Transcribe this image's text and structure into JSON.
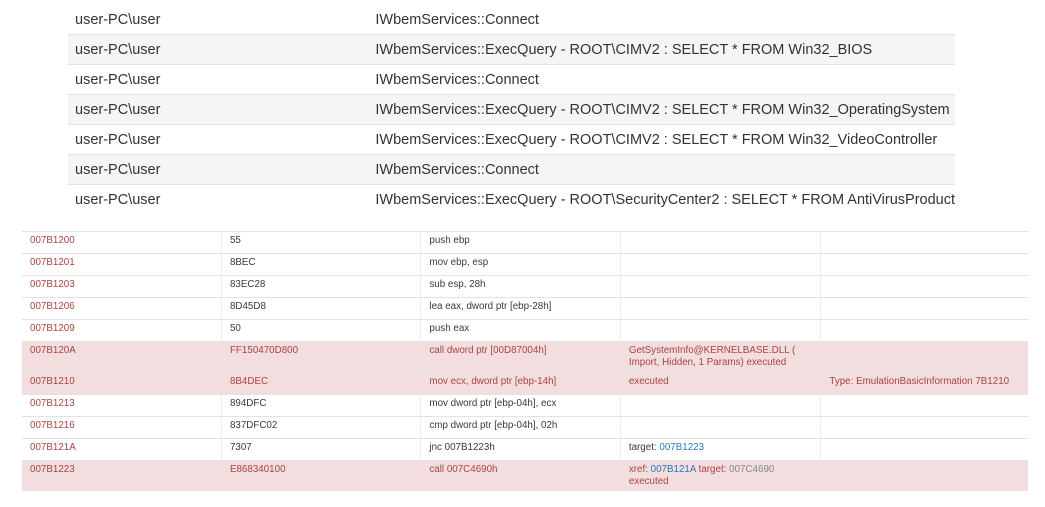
{
  "wmi_calls": {
    "rows": [
      {
        "user": "user-PC\\user",
        "call": "IWbemServices::Connect"
      },
      {
        "user": "user-PC\\user",
        "call": "IWbemServices::ExecQuery - ROOT\\CIMV2 : SELECT * FROM Win32_BIOS"
      },
      {
        "user": "user-PC\\user",
        "call": "IWbemServices::Connect"
      },
      {
        "user": "user-PC\\user",
        "call": "IWbemServices::ExecQuery - ROOT\\CIMV2 : SELECT * FROM Win32_OperatingSystem"
      },
      {
        "user": "user-PC\\user",
        "call": "IWbemServices::ExecQuery - ROOT\\CIMV2 : SELECT * FROM Win32_VideoController"
      },
      {
        "user": "user-PC\\user",
        "call": "IWbemServices::Connect"
      },
      {
        "user": "user-PC\\user",
        "call": "IWbemServices::ExecQuery - ROOT\\SecurityCenter2 : SELECT * FROM AntiVirusProduct"
      }
    ]
  },
  "disassembly": {
    "highlight_color": "#f2dede",
    "highlight_text_color": "#a94442",
    "link_color": "#2a7ab8",
    "rows": [
      {
        "address": "007B1200",
        "bytes": "55",
        "instruction": "push ebp",
        "info": "",
        "extra": ""
      },
      {
        "address": "007B1201",
        "bytes": "8BEC",
        "instruction": "mov ebp, esp",
        "info": "",
        "extra": ""
      },
      {
        "address": "007B1203",
        "bytes": "83EC28",
        "instruction": "sub esp, 28h",
        "info": "",
        "extra": ""
      },
      {
        "address": "007B1206",
        "bytes": "8D45D8",
        "instruction": "lea eax, dword ptr [ebp-28h]",
        "info": "",
        "extra": ""
      },
      {
        "address": "007B1209",
        "bytes": "50",
        "instruction": "push eax",
        "info": "",
        "extra": ""
      },
      {
        "address": "007B120A",
        "bytes": "FF150470D800",
        "instruction": "call dword ptr [00D87004h]",
        "info": "GetSystemInfo@KERNELBASE.DLL ( Import, Hidden, 1 Params) executed",
        "extra": ""
      },
      {
        "address": "007B1210",
        "bytes": "8B4DEC",
        "instruction": "mov ecx, dword ptr [ebp-14h]",
        "info": "executed",
        "extra": "Type: EmulationBasicInformation 7B1210"
      },
      {
        "address": "007B1213",
        "bytes": "894DFC",
        "instruction": "mov dword ptr [ebp-04h], ecx",
        "info": "",
        "extra": ""
      },
      {
        "address": "007B1216",
        "bytes": "837DFC02",
        "instruction": "cmp dword ptr [ebp-04h], 02h",
        "info": "",
        "extra": ""
      },
      {
        "address": "007B121A",
        "bytes": "7307",
        "instruction": "jnc 007B1223h",
        "info_label": "target:",
        "info_link": "007B1223",
        "extra": ""
      },
      {
        "address": "007B1223",
        "bytes": "E868340100",
        "instruction": "call 007C4690h",
        "xref_label": "xref:",
        "xref_link": "007B121A",
        "target_label": "target:",
        "target_value": "007C4690",
        "executed_label": "executed",
        "extra": ""
      }
    ]
  }
}
